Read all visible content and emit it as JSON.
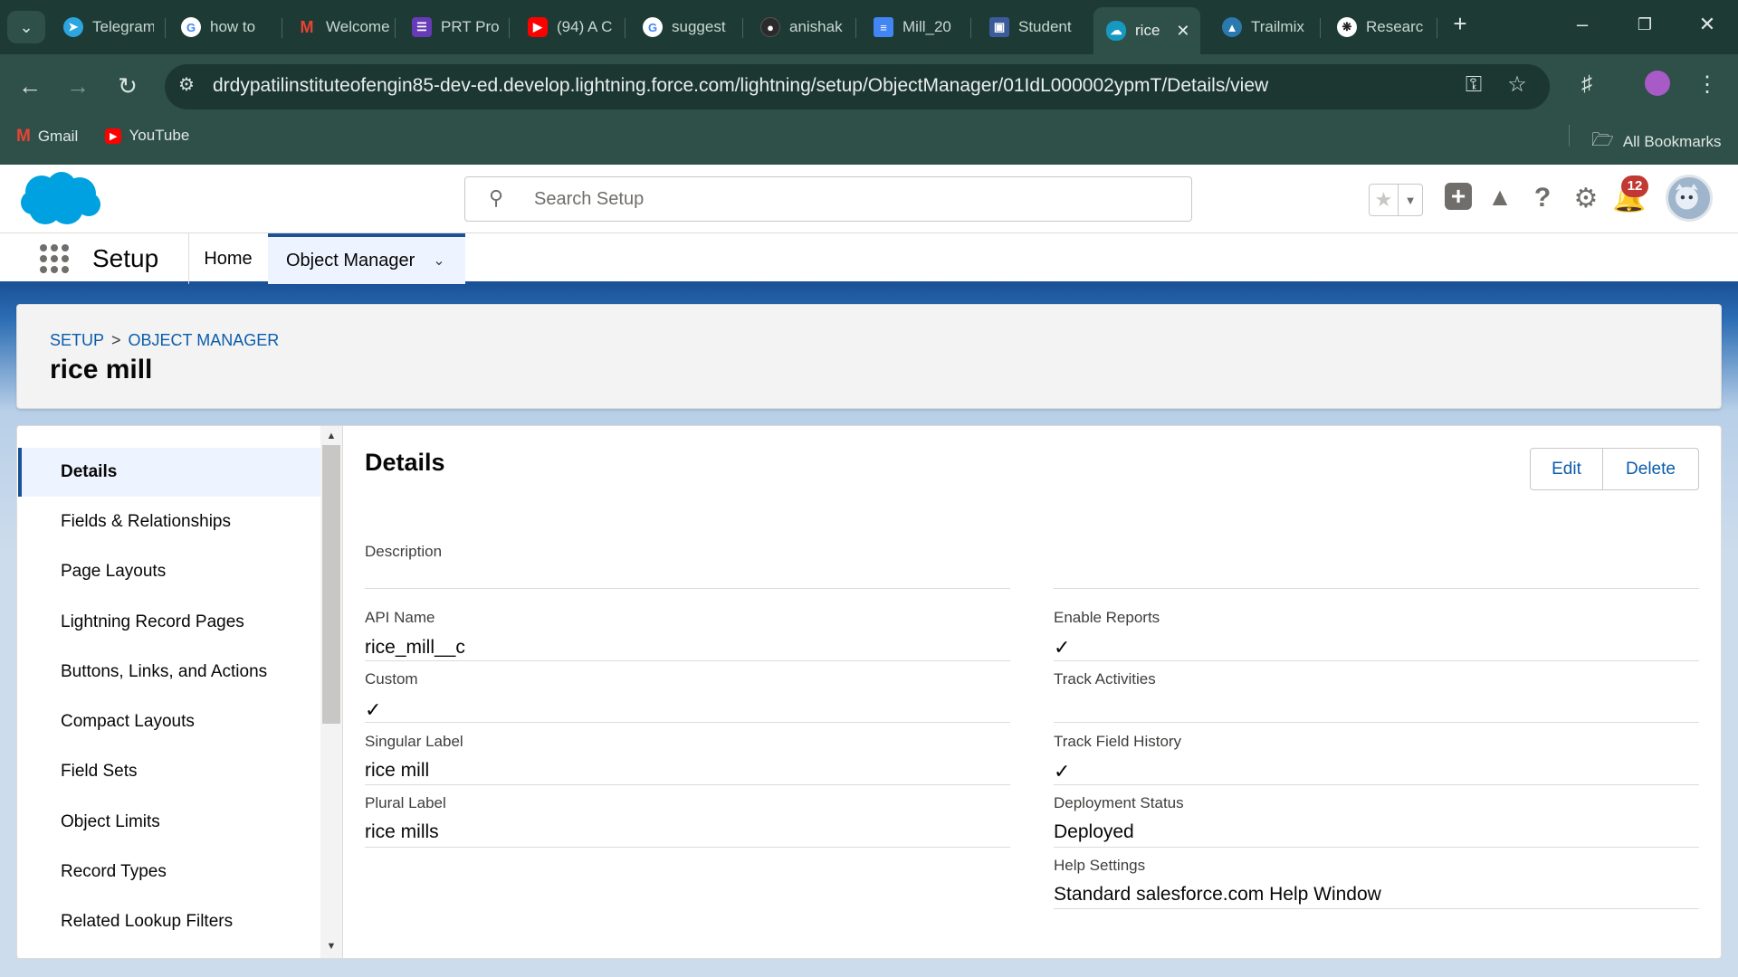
{
  "browser": {
    "tabs": [
      {
        "title": "Telegram",
        "icon": "telegram-icon",
        "color": "#2ca5e0"
      },
      {
        "title": "how to",
        "icon": "google-icon",
        "color": "#ffffff"
      },
      {
        "title": "Welcome",
        "icon": "gmail-icon",
        "color": "#ea4335"
      },
      {
        "title": "PRT Pro",
        "icon": "forms-icon",
        "color": "#673ab7"
      },
      {
        "title": "(94) A C",
        "icon": "youtube-icon",
        "color": "#ff0000"
      },
      {
        "title": "suggest",
        "icon": "google-icon",
        "color": "#ffffff"
      },
      {
        "title": "anishak",
        "icon": "github-icon",
        "color": "#2b2b2b"
      },
      {
        "title": "Mill_20",
        "icon": "docs-icon",
        "color": "#4285f4"
      },
      {
        "title": "Student",
        "icon": "app-icon",
        "color": "#3b5b9a"
      },
      {
        "title": "rice",
        "icon": "salesforce-icon",
        "color": "#1798c1"
      },
      {
        "title": "Trailmix",
        "icon": "trailhead-icon",
        "color": "#2a7ab0"
      },
      {
        "title": "Researc",
        "icon": "openai-icon",
        "color": "#ffffff"
      }
    ],
    "url": "drdypatilinstituteofengin85-dev-ed.develop.lightning.force.com/lightning/setup/ObjectManager/01IdL000002ypmT/Details/view",
    "bookmarks": [
      {
        "label": "Gmail",
        "icon": "gmail-icon"
      },
      {
        "label": "YouTube",
        "icon": "youtube-icon"
      }
    ],
    "all_bookmarks_label": "All Bookmarks"
  },
  "header": {
    "search_placeholder": "Search Setup",
    "notification_count": "12"
  },
  "appnav": {
    "app_name": "Setup",
    "home_label": "Home",
    "object_manager_label": "Object Manager"
  },
  "breadcrumb": {
    "setup": "SETUP",
    "separator": ">",
    "object_manager": "OBJECT MANAGER"
  },
  "page_title": "rice mill",
  "sidebar": {
    "items": [
      {
        "label": "Details",
        "selected": true
      },
      {
        "label": "Fields & Relationships"
      },
      {
        "label": "Page Layouts"
      },
      {
        "label": "Lightning Record Pages"
      },
      {
        "label": "Buttons, Links, and Actions"
      },
      {
        "label": "Compact Layouts"
      },
      {
        "label": "Field Sets"
      },
      {
        "label": "Object Limits"
      },
      {
        "label": "Record Types"
      },
      {
        "label": "Related Lookup Filters"
      }
    ]
  },
  "details": {
    "title": "Details",
    "edit_label": "Edit",
    "delete_label": "Delete",
    "left_fields": {
      "description_label": "Description",
      "description_value": "",
      "api_name_label": "API Name",
      "api_name_value": "rice_mill__c",
      "custom_label": "Custom",
      "custom_checked": true,
      "singular_label_label": "Singular Label",
      "singular_label_value": "rice mill",
      "plural_label_label": "Plural Label",
      "plural_label_value": "rice mills"
    },
    "right_fields": {
      "enable_reports_label": "Enable Reports",
      "enable_reports_checked": true,
      "track_activities_label": "Track Activities",
      "track_activities_checked": false,
      "track_field_history_label": "Track Field History",
      "track_field_history_checked": true,
      "deployment_status_label": "Deployment Status",
      "deployment_status_value": "Deployed",
      "help_settings_label": "Help Settings",
      "help_settings_value": "Standard salesforce.com Help Window"
    }
  },
  "colors": {
    "brand": "#1b5297",
    "link": "#0b5cab",
    "chrome_dark": "#1d3b34",
    "chrome_toolbar": "#2f5048",
    "notification": "#c23934"
  }
}
